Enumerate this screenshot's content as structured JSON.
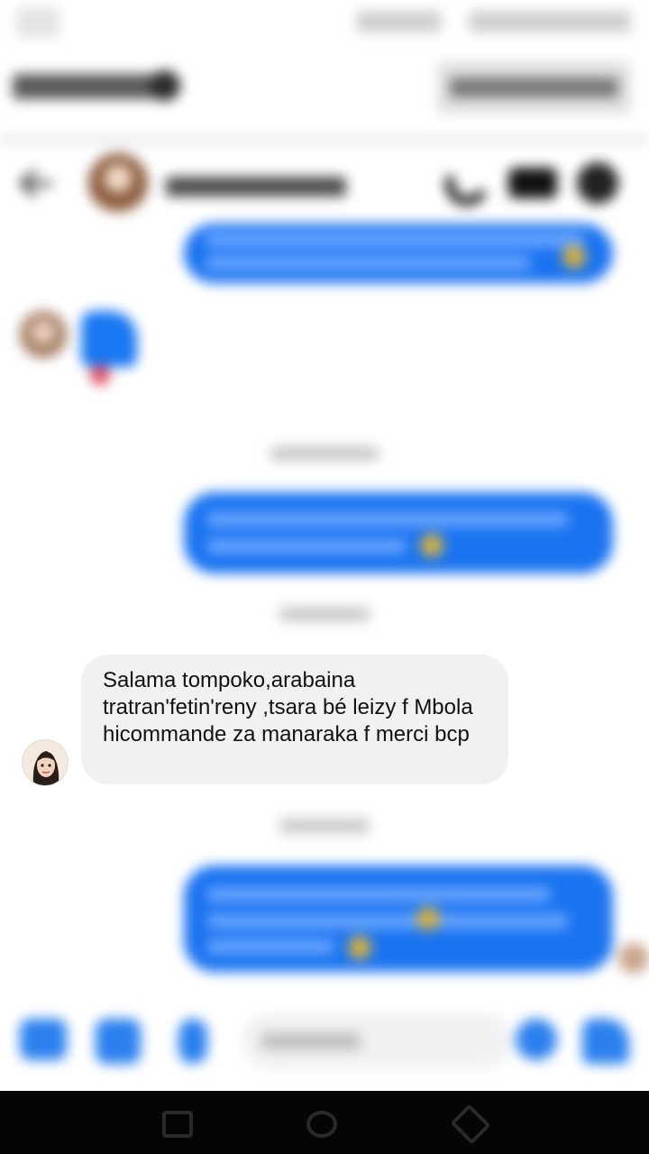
{
  "conversation": {
    "incoming_message": "Salama tompoko,arabaina tratran'fetin'reny ,tsara bé leizy f Mbola hicommande za manaraka f merci bcp"
  },
  "icons": {
    "back": "back-arrow-icon",
    "call": "phone-icon",
    "video": "video-camera-icon",
    "info": "info-icon",
    "like": "thumbs-up-icon",
    "camera": "camera-icon",
    "gallery": "gallery-icon",
    "mic": "microphone-icon",
    "emoji": "emoji-icon"
  },
  "colors": {
    "outgoing_bubble": "#1a73f0",
    "incoming_bubble": "#f1f1f3",
    "accent": "#1877f2"
  }
}
